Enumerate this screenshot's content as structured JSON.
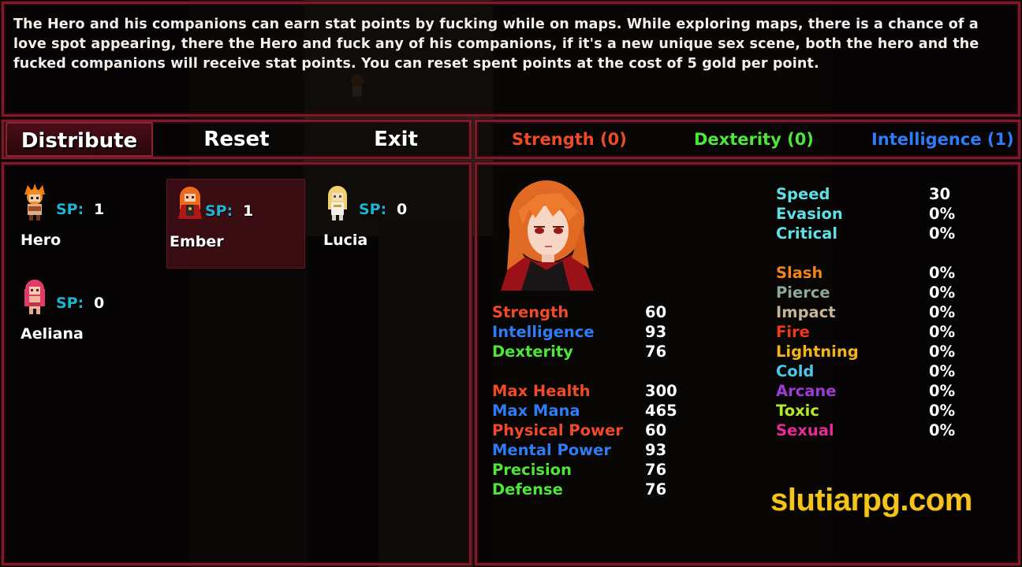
{
  "help_text": "The Hero and his companions can earn stat points by fucking while on maps. While exploring maps, there is a chance of a love spot appearing, there the Hero and fuck any of his companions, if it's a new unique sex scene, both the hero and the fucked companions will receive stat points. You can reset spent points at the cost of 5 gold per point.",
  "commands": {
    "distribute": "Distribute",
    "reset": "Reset",
    "exit": "Exit"
  },
  "stat_tabs": {
    "strength": "Strength (0)",
    "dexterity": "Dexterity (0)",
    "intelligence": "Intelligence (1)",
    "colors": {
      "strength": "#f04a28",
      "dexterity": "#4ee63a",
      "intelligence": "#2e7cf6"
    }
  },
  "actors": [
    {
      "name": "Hero",
      "sp_label": "SP:",
      "sp": "1",
      "selected": false
    },
    {
      "name": "Ember",
      "sp_label": "SP:",
      "sp": "1",
      "selected": true
    },
    {
      "name": "Lucia",
      "sp_label": "SP:",
      "sp": "0",
      "selected": false
    },
    {
      "name": "Aeliana",
      "sp_label": "SP:",
      "sp": "0",
      "selected": false
    }
  ],
  "status": {
    "portrait_icon": "ember-portrait",
    "primary": [
      {
        "label": "Strength",
        "value": "60",
        "color": "#f04a28"
      },
      {
        "label": "Intelligence",
        "value": "93",
        "color": "#2e7cf6"
      },
      {
        "label": "Dexterity",
        "value": "76",
        "color": "#4ee63a"
      }
    ],
    "derived": [
      {
        "label": "Max Health",
        "value": "300",
        "color": "#f04a28"
      },
      {
        "label": "Max Mana",
        "value": "465",
        "color": "#2e7cf6"
      },
      {
        "label": "Physical Power",
        "value": "60",
        "color": "#f04a28"
      },
      {
        "label": "Mental Power",
        "value": "93",
        "color": "#2e7cf6"
      },
      {
        "label": "Precision",
        "value": "76",
        "color": "#4ee63a"
      },
      {
        "label": "Defense",
        "value": "76",
        "color": "#4ee63a"
      }
    ],
    "combat": [
      {
        "label": "Speed",
        "value": "30",
        "color": "#5ee0e6"
      },
      {
        "label": "Evasion",
        "value": "0%",
        "color": "#5ee0e6"
      },
      {
        "label": "Critical",
        "value": "0%",
        "color": "#5ee0e6"
      }
    ],
    "resist": [
      {
        "label": "Slash",
        "value": "0%",
        "color": "#f2841a"
      },
      {
        "label": "Pierce",
        "value": "0%",
        "color": "#8fa89a"
      },
      {
        "label": "Impact",
        "value": "0%",
        "color": "#c8b49a"
      },
      {
        "label": "Fire",
        "value": "0%",
        "color": "#f03a1a"
      },
      {
        "label": "Lightning",
        "value": "0%",
        "color": "#f6b21e"
      },
      {
        "label": "Cold",
        "value": "0%",
        "color": "#4cc6ea"
      },
      {
        "label": "Arcane",
        "value": "0%",
        "color": "#9e3ad8"
      },
      {
        "label": "Toxic",
        "value": "0%",
        "color": "#b4ea2a"
      },
      {
        "label": "Sexual",
        "value": "0%",
        "color": "#ea2a9a"
      }
    ]
  },
  "watermark": "slutiarpg.com"
}
